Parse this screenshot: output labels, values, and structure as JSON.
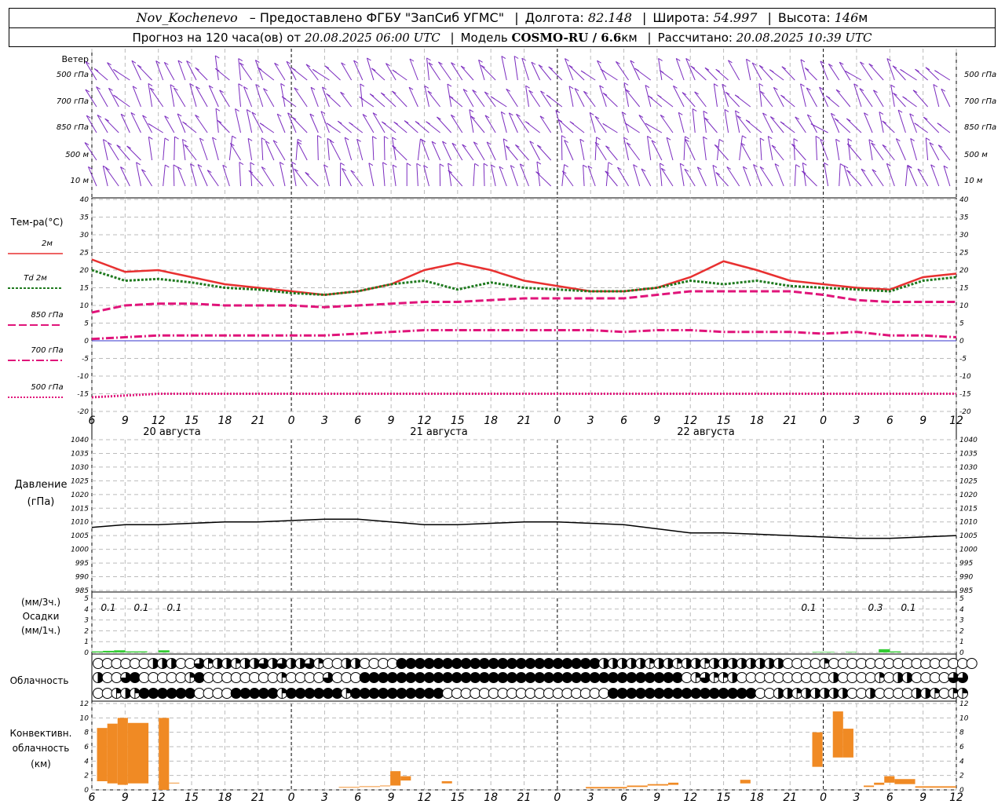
{
  "header": {
    "station": "Nov_Kochenevo",
    "provider": "– Предоставлено ФГБУ \"ЗапСиб УГМС\"",
    "lon_label": "Долгота:",
    "lon": "82.148",
    "lat_label": "Широта:",
    "lat": "54.997",
    "alt_label": "Высота:",
    "alt": "146",
    "alt_unit": "м",
    "forecast_label": "Прогноз на 120 часа(ов) от",
    "forecast_from": "20.08.2025 06:00 UTC",
    "model_label": "Модель",
    "model": "COSMO-RU / 6.6",
    "model_unit": "км",
    "calc_label": "Рассчитано:",
    "calc": "20.08.2025 10:39 UTC"
  },
  "time_axis": {
    "hours": [
      "6",
      "9",
      "12",
      "15",
      "18",
      "21",
      "0",
      "3",
      "6",
      "9",
      "12",
      "15",
      "18",
      "21",
      "0",
      "3",
      "6",
      "9",
      "12",
      "15",
      "18",
      "21",
      "0",
      "3",
      "6",
      "9",
      "12"
    ],
    "days": [
      "20 августа",
      "21 августа",
      "22 августа"
    ]
  },
  "wind": {
    "title": "Ветер",
    "levels_left": [
      "500 гПа",
      "700 гПа",
      "850 гПа",
      "500  м",
      "10   м"
    ],
    "levels_right": [
      "500 гПа",
      "700 гПа",
      "850 гПа",
      "500  м",
      "10   м"
    ]
  },
  "temperature": {
    "title": "Тем-ра(°C)",
    "legend": [
      "2м",
      "Td  2м",
      "850 гПа",
      "700 гПа",
      "500 гПа"
    ],
    "ticks": [
      "40",
      "35",
      "30",
      "25",
      "20",
      "15",
      "10",
      "5",
      "0",
      "-5",
      "-10",
      "-15",
      "-20"
    ]
  },
  "pressure": {
    "title": "Давление",
    "unit": "(гПа)",
    "ticks": [
      "1040",
      "1035",
      "1030",
      "1025",
      "1020",
      "1015",
      "1010",
      "1005",
      "1000",
      "995",
      "990",
      "985"
    ]
  },
  "precip": {
    "unit_top": "(мм/3ч.)",
    "title": "Осадки",
    "unit_bottom": "(мм/1ч.)",
    "ticks": [
      "5",
      "4",
      "3",
      "2",
      "1",
      "0"
    ],
    "labels": [
      "0.1",
      "0.1",
      "0.1",
      "0.1",
      "0.3",
      "0.1"
    ]
  },
  "cloud": {
    "title": "Облачность"
  },
  "convective": {
    "title1": "Конвективн.",
    "title2": "облачность",
    "unit": "(км)",
    "ticks": [
      "12",
      "10",
      "8",
      "6",
      "4",
      "2",
      "0"
    ]
  },
  "colors": {
    "t2m": "#e83030",
    "td": "#1f7a1f",
    "p850": "#e0147a",
    "p700": "#e0147a",
    "p500": "#e0147a",
    "wind": "#7b2cbf",
    "precip": "#33cc33",
    "conv": "#f08a24",
    "zero_line": "#3333cc"
  },
  "chart_data": [
    {
      "type": "line",
      "name": "temperature",
      "x": [
        0,
        3,
        6,
        9,
        12,
        15,
        18,
        21,
        24,
        27,
        30,
        33,
        36,
        39,
        42,
        45,
        48,
        51,
        54,
        57,
        60,
        63,
        66,
        69,
        72,
        75,
        78
      ],
      "ylim": [
        -20,
        40
      ],
      "series": [
        {
          "name": "2м",
          "values": [
            23,
            19.5,
            20,
            18,
            16,
            15,
            14,
            13,
            14,
            16,
            20,
            22,
            20,
            17,
            15.5,
            14,
            14,
            15,
            18,
            22.5,
            20,
            17,
            16,
            15,
            14.5,
            18,
            19
          ]
        },
        {
          "name": "Td  2м",
          "values": [
            20,
            17,
            17.5,
            16.5,
            15,
            14.5,
            13.5,
            13,
            14,
            16,
            17,
            14.5,
            16.5,
            15,
            14.5,
            14,
            14,
            15,
            17,
            16,
            17,
            15.5,
            15,
            14.5,
            14,
            17,
            18
          ]
        },
        {
          "name": "850 гПа",
          "values": [
            8,
            10,
            10.5,
            10.5,
            10,
            10,
            10,
            9.5,
            10,
            10.5,
            11,
            11,
            11.5,
            12,
            12,
            12,
            12,
            13,
            14,
            14,
            14,
            14,
            13,
            11.5,
            11,
            11,
            11
          ]
        },
        {
          "name": "700 гПа",
          "values": [
            0.5,
            1,
            1.5,
            1.5,
            1.5,
            1.5,
            1.5,
            1.5,
            2,
            2.5,
            3,
            3,
            3,
            3,
            3,
            3,
            2.5,
            3,
            3,
            2.5,
            2.5,
            2.5,
            2,
            2.5,
            1.5,
            1.5,
            1
          ]
        },
        {
          "name": "500 гПа",
          "values": [
            -16,
            -15.5,
            -15,
            -15,
            -15,
            -15,
            -15,
            -15,
            -15,
            -15,
            -15,
            -15,
            -15,
            -15,
            -15,
            -15,
            -15,
            -15,
            -15,
            -15,
            -15,
            -15,
            -15,
            -15,
            -15,
            -15,
            -15
          ]
        }
      ]
    },
    {
      "type": "line",
      "name": "pressure",
      "x": [
        0,
        3,
        6,
        9,
        12,
        15,
        18,
        21,
        24,
        27,
        30,
        33,
        36,
        39,
        42,
        45,
        48,
        51,
        54,
        57,
        60,
        63,
        66,
        69,
        72,
        75,
        78
      ],
      "ylim": [
        985,
        1040
      ],
      "series": [
        {
          "name": "pressure",
          "values": [
            1008,
            1009,
            1009,
            1009.5,
            1010,
            1010,
            1010.5,
            1011,
            1011,
            1010,
            1009,
            1009,
            1009.5,
            1010,
            1010,
            1009.5,
            1009,
            1007.5,
            1006,
            1006,
            1005.5,
            1005,
            1004.5,
            1004,
            1004,
            1004.5,
            1005
          ]
        }
      ]
    },
    {
      "type": "bar",
      "name": "precipitation",
      "ylim": [
        0,
        5
      ],
      "x": [
        0,
        1,
        2,
        3,
        4,
        5,
        6,
        65,
        66,
        67,
        68,
        69,
        70,
        71,
        72
      ],
      "values": [
        0.1,
        0.15,
        0.2,
        0.1,
        0.1,
        0,
        0.2,
        0.05,
        0.05,
        0,
        0.05,
        0,
        0,
        0.3,
        0.1
      ]
    },
    {
      "type": "bar",
      "name": "convective",
      "ylim": [
        0,
        12
      ],
      "bars": [
        {
          "x": 0.5,
          "w": 1,
          "base": 1.2,
          "top": 8.6
        },
        {
          "x": 1.5,
          "w": 1,
          "base": 0.9,
          "top": 9.2
        },
        {
          "x": 2.5,
          "w": 1,
          "base": 0.7,
          "top": 10
        },
        {
          "x": 3.5,
          "w": 2,
          "base": 0.9,
          "top": 9.3
        },
        {
          "x": 6.5,
          "w": 1,
          "base": 0,
          "top": 10
        },
        {
          "x": 7.5,
          "w": 1,
          "base": 0.9,
          "top": 1
        },
        {
          "x": 24,
          "w": 2,
          "base": 0.3,
          "top": 0.4
        },
        {
          "x": 26,
          "w": 2,
          "base": 0.4,
          "top": 0.5
        },
        {
          "x": 28,
          "w": 1,
          "base": 0.5,
          "top": 0.6
        },
        {
          "x": 29,
          "w": 1,
          "base": 0.6,
          "top": 2.6
        },
        {
          "x": 30,
          "w": 1,
          "base": 1.3,
          "top": 1.9
        },
        {
          "x": 34,
          "w": 1,
          "base": 0.9,
          "top": 1.2
        },
        {
          "x": 48,
          "w": 4,
          "base": 0.2,
          "top": 0.4
        },
        {
          "x": 52,
          "w": 2,
          "base": 0.4,
          "top": 0.6
        },
        {
          "x": 54,
          "w": 2,
          "base": 0.6,
          "top": 0.8
        },
        {
          "x": 56,
          "w": 1,
          "base": 0.7,
          "top": 1
        },
        {
          "x": 63,
          "w": 1,
          "base": 0.9,
          "top": 1.4
        },
        {
          "x": 70,
          "w": 1,
          "base": 3.2,
          "top": 8
        },
        {
          "x": 71,
          "w": 1,
          "base": 0,
          "top": 0
        },
        {
          "x": 72,
          "w": 1,
          "base": 4.5,
          "top": 10.9
        },
        {
          "x": 73,
          "w": 1,
          "base": 4.5,
          "top": 8.5
        },
        {
          "x": 75,
          "w": 1,
          "base": 0.4,
          "top": 0.6
        },
        {
          "x": 76,
          "w": 1,
          "base": 0.7,
          "top": 1
        },
        {
          "x": 77,
          "w": 1,
          "base": 1,
          "top": 1.9
        },
        {
          "x": 78,
          "w": 2,
          "base": 0.8,
          "top": 1.5
        },
        {
          "x": 80,
          "w": 4,
          "base": 0.3,
          "top": 0.5
        }
      ]
    }
  ],
  "clouds": {
    "rows": [
      "ffffffhhhffrqhhqhhrhrhhrqffhhffffeeeeeeeeeeeeeeeeeeeeeehhhhhqhhqhhqhhhhhhhhffffqffffffffffffffff",
      "hffrefffffqeffffffffqffffrfffeeeeeeeeeeeeeeeeeeeeeeeeeeeeeeeeeeefqrqqhffffffffffhffffqfhhffffrr",
      "ffqhqeeeeeeffffeeeeeqeeeeeeqeeeeeeeeeeffffffffffffffffffeeeeeeeeeeeeeeeeffhhqhhhhhffhffffhhqfqq"
    ]
  }
}
